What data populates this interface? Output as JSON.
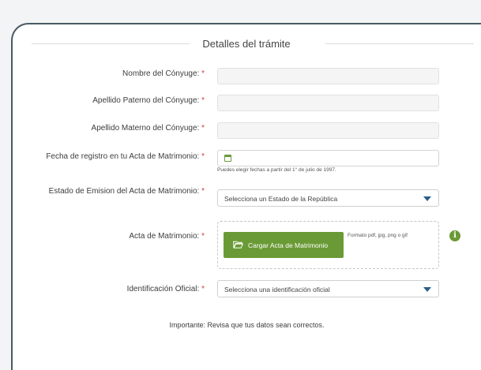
{
  "section_title": "Detalles del trámite",
  "required_mark": "*",
  "fields": {
    "nombre": {
      "label": "Nombre del Cónyuge:",
      "value": ""
    },
    "apellido_paterno": {
      "label": "Apellido Paterno del Cónyuge:",
      "value": ""
    },
    "apellido_materno": {
      "label": "Apellido Materno del Cónyuge:",
      "value": ""
    },
    "fecha_registro": {
      "label": "Fecha de registro en tu Acta de Matrimonio:",
      "value": "",
      "hint": "Puedes elegir fechas a partir del 1° de julio de 1997."
    },
    "estado_emision": {
      "label": "Estado de Emision del Acta de Matrimonio:",
      "selected": "Selecciona un Estado de la República"
    },
    "acta_matrimonio": {
      "label": "Acta de Matrimonio:",
      "button_label": "Cargar Acta de Matrimonio",
      "format_note": "Formato pdf, jpg, png o gif",
      "info_glyph": "i"
    },
    "identificacion": {
      "label": "Identificación Oficial:",
      "selected": "Selecciona una identificación oficial"
    }
  },
  "important_note": "Importante: Revisa que tus datos sean correctos.",
  "colors": {
    "accent_green": "#6a9a35",
    "required_red": "#d13b3b",
    "caret_blue": "#2a5f8e",
    "frame": "#4a5a64"
  },
  "icons": {
    "calendar": "calendar-icon",
    "folder": "folder-icon",
    "info": "info-icon",
    "dropdown": "chevron-down-icon"
  }
}
